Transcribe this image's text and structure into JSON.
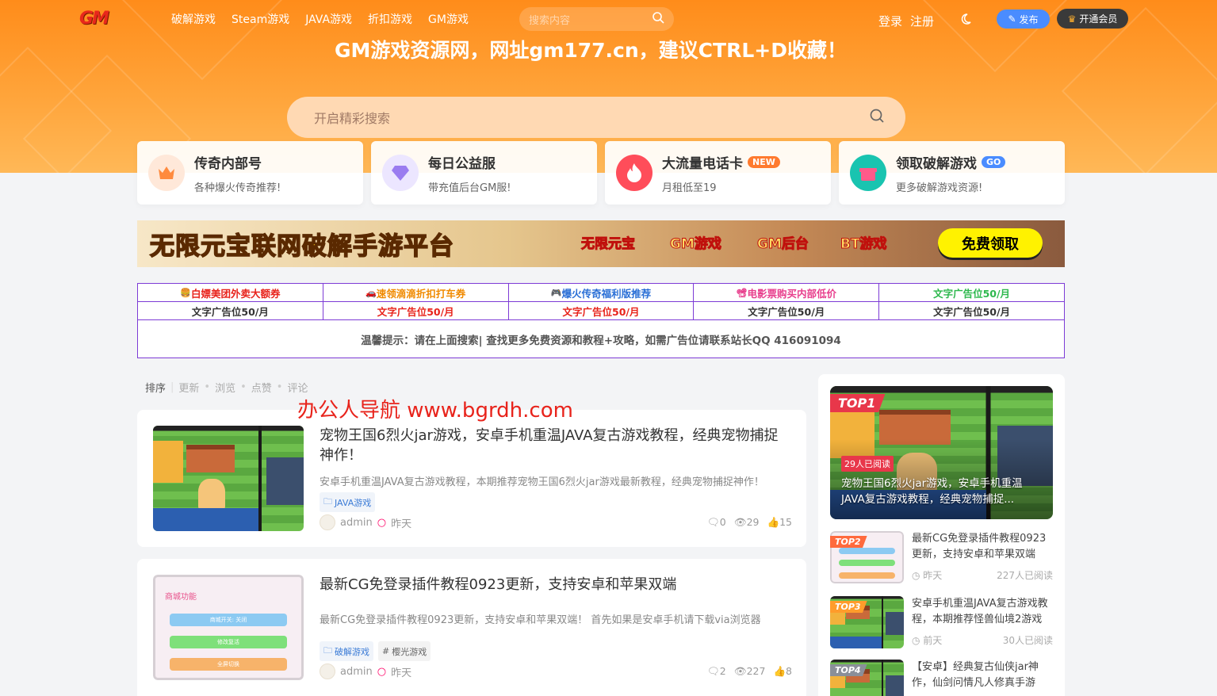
{
  "nav": {
    "logo": "GM",
    "menu": [
      "破解游戏",
      "Steam游戏",
      "JAVA游戏",
      "折扣游戏",
      "GM游戏"
    ],
    "search_placeholder": "搜索内容",
    "login": "登录",
    "register": "注册",
    "publish": "发布",
    "vip": "开通会员"
  },
  "hero": {
    "slogan": "GM游戏资源网，网址gm177.cn，建议CTRL+D收藏！",
    "search_placeholder": "开启精彩搜索"
  },
  "cards": [
    {
      "title": "传奇内部号",
      "sub": "各种爆火传奇推荐!",
      "badge": "",
      "icon": "crown-icon",
      "color": "#ffe8d9",
      "fg": "#ff8a3d"
    },
    {
      "title": "每日公益服",
      "sub": "带充值后台GM服!",
      "badge": "",
      "icon": "diamond-icon",
      "color": "#ece6ff",
      "fg": "#9a7cf0"
    },
    {
      "title": "大流量电话卡",
      "sub": "月租低至19",
      "badge": "NEW",
      "icon": "fire-icon",
      "color": "#ff4d5a",
      "fg": "#ffffff"
    },
    {
      "title": "领取破解游戏",
      "sub": "更多破解游戏资源!",
      "badge": "GO",
      "icon": "gift-icon",
      "color": "#19c4b0",
      "fg": "#ff5a8a"
    }
  ],
  "banner": {
    "title": "无限元宝联网破解手游平台",
    "tags": [
      "无限元宝",
      "GM游戏",
      "GM后台",
      "BT游戏"
    ],
    "button": "免费领取"
  },
  "ads": {
    "row1": [
      {
        "text": "白嫖美团外卖大额券",
        "color": "#e8231b",
        "icon": "🍔"
      },
      {
        "text": "速领滴滴折扣打车券",
        "color": "#f08a00",
        "icon": "🚗"
      },
      {
        "text": "爆火传奇福利版推荐",
        "color": "#2a6fd6",
        "icon": "🎮"
      },
      {
        "text": "电影票购买内部低价",
        "color": "#e83e8c",
        "icon": "📽"
      },
      {
        "text": "文字广告位50/月",
        "color": "#2db84d",
        "icon": ""
      }
    ],
    "row2": [
      {
        "text": "文字广告位50/月",
        "color": "#333333"
      },
      {
        "text": "文字广告位50/月",
        "color": "#e8231b"
      },
      {
        "text": "文字广告位50/月",
        "color": "#e8231b"
      },
      {
        "text": "文字广告位50/月",
        "color": "#333333"
      },
      {
        "text": "文字广告位50/月",
        "color": "#333333"
      }
    ],
    "note": "温馨提示：请在上面搜索| 查找更多免费资源和教程+攻略，如需广告位请联系站长QQ 416091094"
  },
  "sort": {
    "label": "排序",
    "options": [
      "更新",
      "浏览",
      "点赞",
      "评论"
    ]
  },
  "watermark": "办公人导航  www.bgrdh.com",
  "posts": [
    {
      "title": "宠物王国6烈火jar游戏，安卓手机重温JAVA复古游戏教程，经典宠物捕捉神作！",
      "excerpt": "安卓手机重温JAVA复古游戏教程，本期推荐宠物王国6烈火jar游戏最新教程，经典宠物捕捉神作！",
      "tags": [
        {
          "text": "JAVA游戏",
          "type": "folder"
        }
      ],
      "author": "admin",
      "time": "昨天",
      "comments": "0",
      "views": "29",
      "likes": "15"
    },
    {
      "title": "最新CG免登录插件教程0923更新，支持安卓和苹果双端",
      "excerpt": "最新CG免登录插件教程0923更新，支持安卓和苹果双端！ 首先如果是安卓手机请下载via浏览器",
      "tags": [
        {
          "text": "破解游戏",
          "type": "folder"
        },
        {
          "text": "樱光游戏",
          "type": "hash"
        }
      ],
      "author": "admin",
      "time": "昨天",
      "comments": "2",
      "views": "227",
      "likes": "8",
      "thumb_title": "商城功能",
      "thumb_buttons": [
        "商城开关: 关闭",
        "修改复活",
        "全屏切换"
      ]
    }
  ],
  "sidebar": {
    "top1": {
      "badge": "TOP1",
      "read": "29人已阅读",
      "title": "宠物王国6烈火jar游戏，安卓手机重温JAVA复古游戏教程，经典宠物捕捉..."
    },
    "items": [
      {
        "badge": "TOP2",
        "badge_color": "#ff6a3d",
        "title": "最新CG免登录插件教程0923更新，支持安卓和苹果双端",
        "time": "昨天",
        "read": "227人已阅读"
      },
      {
        "badge": "TOP3",
        "badge_color": "#ff9c2b",
        "title": "安卓手机重温JAVA复古游戏教程，本期推荐怪兽仙境2游戏",
        "time": "前天",
        "read": "30人已阅读"
      },
      {
        "badge": "TOP4",
        "badge_color": "#8a8f99",
        "title": "【安卓】经典复古仙侠jar神作，仙剑问情凡人修真手游",
        "time": "",
        "read": ""
      }
    ]
  }
}
